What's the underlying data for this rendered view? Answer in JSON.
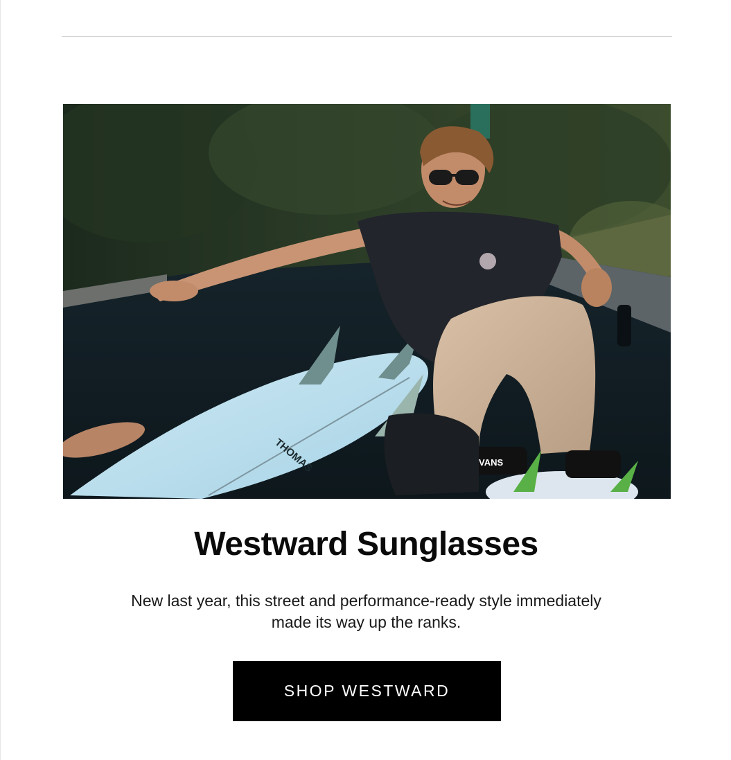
{
  "product": {
    "title": "Westward Sunglasses",
    "description": "New last year, this street and performance-ready style immediately made its way up the ranks."
  },
  "cta": {
    "label": "SHOP WESTWARD"
  },
  "hero": {
    "alt": "",
    "board_brand": "THOMAS",
    "shoe_brand": "VANS"
  },
  "colors": {
    "background": "#ffffff",
    "button_bg": "#000000",
    "button_text": "#ffffff",
    "divider": "#cfcfcf"
  }
}
